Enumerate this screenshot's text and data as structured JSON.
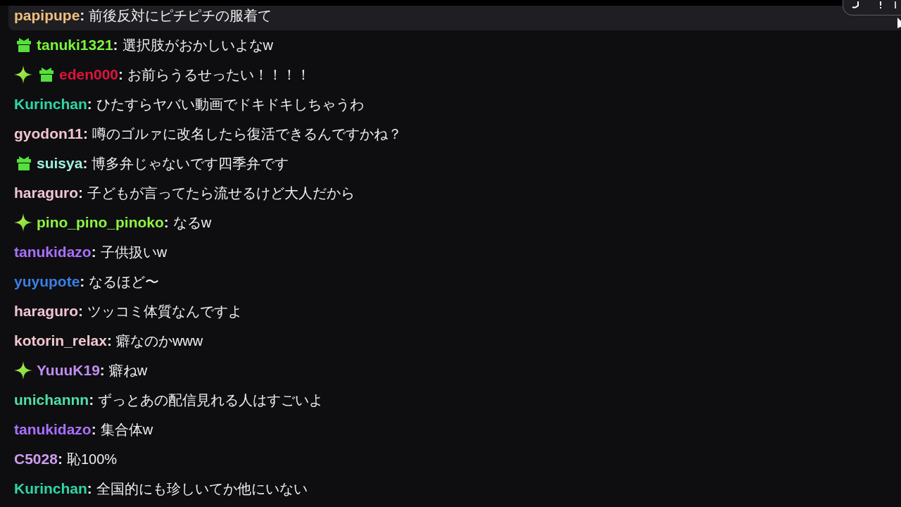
{
  "messages": [
    {
      "username": "papipupe",
      "color": "#f2bf7c",
      "separator": ":",
      "text": "前後反対にピチピチの服着て",
      "highlighted": true
    },
    {
      "badges": [
        {
          "kind": "gift"
        }
      ],
      "username": "tanuki1321",
      "color": "#7bf53c",
      "separator": ":",
      "text": "選択肢がおかしいよなw",
      "highlighted": false
    },
    {
      "badges": [
        {
          "kind": "sparkle"
        },
        {
          "kind": "gift"
        }
      ],
      "username": "eden000",
      "color": "#dc143c",
      "separator": ":",
      "text": "お前らうるせったい！！！！",
      "highlighted": false
    },
    {
      "username": "Kurinchan",
      "color": "#2fd6a4",
      "separator": ":",
      "text": "ひたすらヤバい動画でドキドキしちゃうわ",
      "highlighted": false
    },
    {
      "username": "gyodon11",
      "color": "#f2c4cf",
      "separator": ":",
      "text": "噂のゴルァに改名したら復活できるんですかね？",
      "highlighted": false
    },
    {
      "badges": [
        {
          "kind": "gift"
        }
      ],
      "username": "suisya",
      "color": "#9ff0df",
      "separator": ":",
      "text": "博多弁じゃないです四季弁です",
      "highlighted": false
    },
    {
      "username": "haraguro",
      "color": "#f2c4d6",
      "separator": ":",
      "text": "子どもが言ってたら流せるけど大人だから",
      "highlighted": false
    },
    {
      "badges": [
        {
          "kind": "sparkle"
        }
      ],
      "username": "pino_pino_pinoko",
      "color": "#8cf542",
      "separator": ":",
      "text": "なるw",
      "highlighted": false
    },
    {
      "username": "tanukidazo",
      "color": "#a970ff",
      "separator": ":",
      "text": "子供扱いw",
      "highlighted": false
    },
    {
      "username": "yuyupote",
      "color": "#3a7fe6",
      "separator": ":",
      "text": "なるほど〜",
      "highlighted": false
    },
    {
      "username": "haraguro",
      "color": "#f2c4d6",
      "separator": ":",
      "text": "ツッコミ体質なんですよ",
      "highlighted": false
    },
    {
      "username": "kotorin_relax",
      "color": "#f2c8d0",
      "separator": ":",
      "text": "癖なのかwww",
      "highlighted": false
    },
    {
      "badges": [
        {
          "kind": "sparkle"
        }
      ],
      "username": "YuuuK19",
      "color": "#c08cf5",
      "separator": ":",
      "text": "癖ねw",
      "highlighted": false
    },
    {
      "username": "unichannn",
      "color": "#4fe0a8",
      "separator": ":",
      "text": "ずっとあの配信見れる人はすごいよ",
      "highlighted": false
    },
    {
      "username": "tanukidazo",
      "color": "#a970ff",
      "separator": ":",
      "text": "集合体w",
      "highlighted": false
    },
    {
      "username": "C5028",
      "color": "#cf9cf0",
      "separator": ":",
      "text": "恥100%",
      "highlighted": false
    },
    {
      "username": "Kurinchan",
      "color": "#2fd6a4",
      "separator": ":",
      "text": "全国的にも珍しいてか他にいない",
      "highlighted": false
    }
  ]
}
